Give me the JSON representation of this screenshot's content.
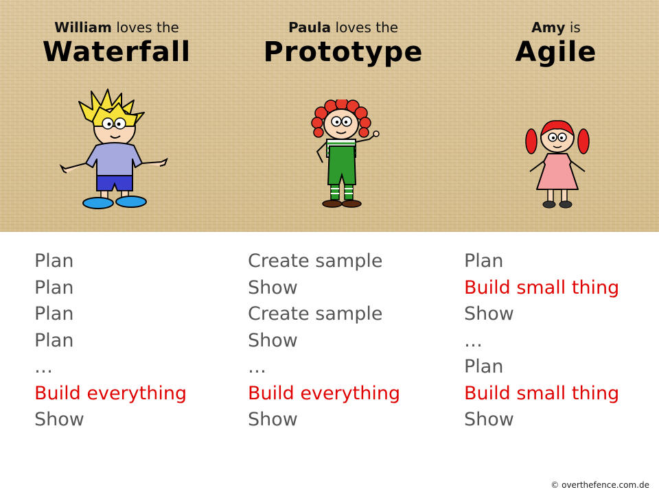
{
  "columns": [
    {
      "name": "William",
      "phrase": " loves the",
      "method": "Waterfall",
      "character_icon": "boy-spiky-hair-icon",
      "steps": [
        {
          "text": "Plan",
          "highlight": false
        },
        {
          "text": "Plan",
          "highlight": false
        },
        {
          "text": "Plan",
          "highlight": false
        },
        {
          "text": "Plan",
          "highlight": false
        },
        {
          "text": "…",
          "highlight": false
        },
        {
          "text": "Build everything",
          "highlight": true
        },
        {
          "text": "Show",
          "highlight": false
        }
      ]
    },
    {
      "name": "Paula",
      "phrase": " loves the",
      "method": "Prototype",
      "character_icon": "girl-curly-hair-icon",
      "steps": [
        {
          "text": "Create sample",
          "highlight": false
        },
        {
          "text": "Show",
          "highlight": false
        },
        {
          "text": "Create sample",
          "highlight": false
        },
        {
          "text": "Show",
          "highlight": false
        },
        {
          "text": "…",
          "highlight": false
        },
        {
          "text": "Build everything",
          "highlight": true
        },
        {
          "text": "Show",
          "highlight": false
        }
      ]
    },
    {
      "name": "Amy",
      "phrase": " is",
      "method": "Agile",
      "character_icon": "girl-pigtails-icon",
      "steps": [
        {
          "text": "Plan",
          "highlight": false
        },
        {
          "text": "Build small thing",
          "highlight": true
        },
        {
          "text": "Show",
          "highlight": false
        },
        {
          "text": "…",
          "highlight": false
        },
        {
          "text": "Plan",
          "highlight": false
        },
        {
          "text": "Build small thing",
          "highlight": true
        },
        {
          "text": "Show",
          "highlight": false
        }
      ]
    }
  ],
  "footer": {
    "copyright": "© overthefence.com.de"
  },
  "colors": {
    "highlight": "#e00000",
    "text": "#555555",
    "banner": "#d9c49a"
  }
}
